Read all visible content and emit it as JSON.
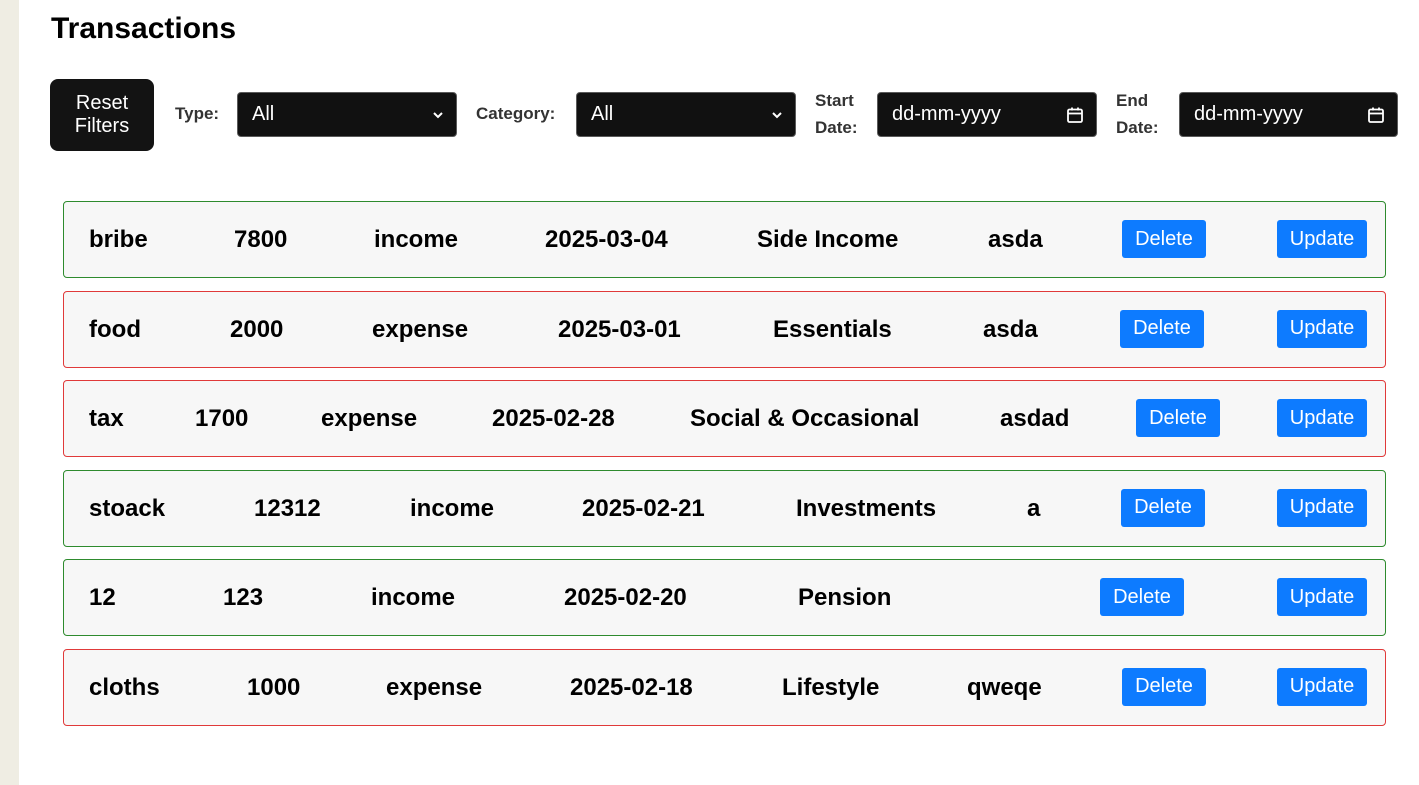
{
  "title": "Transactions",
  "filters": {
    "reset_label": "Reset Filters",
    "type_label": "Type:",
    "type_value": "All",
    "category_label": "Category:",
    "category_value": "All",
    "start_label_1": "Start",
    "start_label_2": "Date:",
    "start_value": "dd-mm-yyyy",
    "end_label_1": "End",
    "end_label_2": "Date:",
    "end_value": "dd-mm-yyyy"
  },
  "actions": {
    "delete_label": "Delete",
    "update_label": "Update"
  },
  "colors": {
    "income_border": "#2e8b2e",
    "expense_border": "#e03a3a",
    "button_blue": "#0d7bff",
    "dark_control": "#111111"
  },
  "transactions": [
    {
      "name": "bribe",
      "amount": "7800",
      "type": "income",
      "date": "2025-03-04",
      "category": "Side Income",
      "note": "asda"
    },
    {
      "name": "food",
      "amount": "2000",
      "type": "expense",
      "date": "2025-03-01",
      "category": "Essentials",
      "note": "asda"
    },
    {
      "name": "tax",
      "amount": "1700",
      "type": "expense",
      "date": "2025-02-28",
      "category": "Social & Occasional",
      "note": "asdad"
    },
    {
      "name": "stoack",
      "amount": "12312",
      "type": "income",
      "date": "2025-02-21",
      "category": "Investments",
      "note": "a"
    },
    {
      "name": "12",
      "amount": "123",
      "type": "income",
      "date": "2025-02-20",
      "category": "Pension",
      "note": ""
    },
    {
      "name": "cloths",
      "amount": "1000",
      "type": "expense",
      "date": "2025-02-18",
      "category": "Lifestyle",
      "note": "qweqe"
    }
  ]
}
